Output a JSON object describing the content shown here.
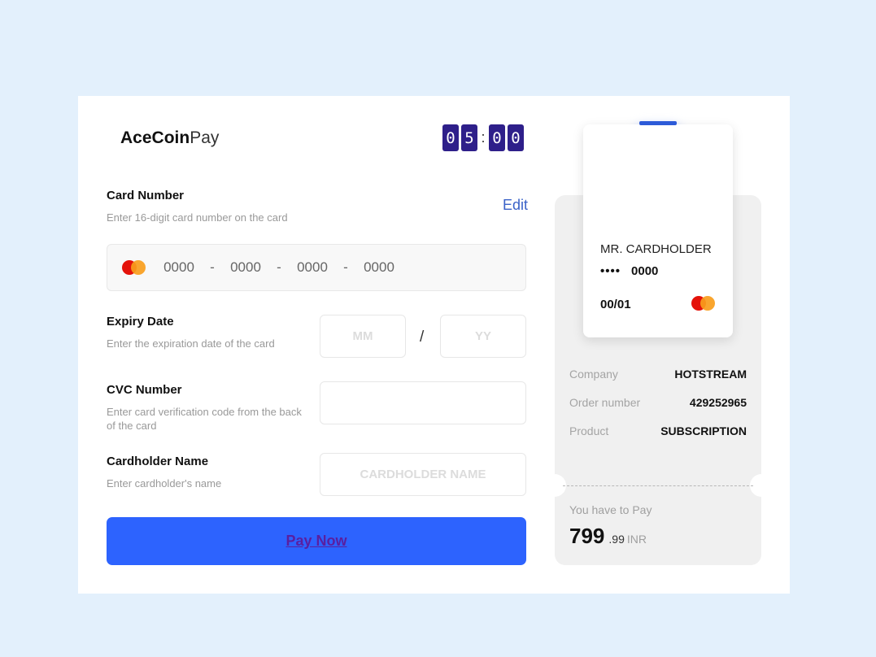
{
  "brand": {
    "bold": "AceCoin",
    "light": "Pay"
  },
  "timer": {
    "d1": "0",
    "d2": "5",
    "sep": ":",
    "d3": "0",
    "d4": "0"
  },
  "card_number": {
    "label": "Card Number",
    "description": "Enter 16-digit card number on the card",
    "edit_label": "Edit",
    "groups": [
      "0000",
      "0000",
      "0000",
      "0000"
    ],
    "separator": "-",
    "icon": "mastercard-icon"
  },
  "expiry": {
    "label": "Expiry Date",
    "description": "Enter the expiration date of the card",
    "month_placeholder": "MM",
    "year_placeholder": "YY",
    "separator": "/"
  },
  "cvc": {
    "label": "CVC Number",
    "description": "Enter card verification code from the back of the card"
  },
  "cardholder": {
    "label": "Cardholder Name",
    "description": "Enter cardholder's name",
    "placeholder": "CARDHOLDER NAME"
  },
  "pay_button": {
    "label": "Pay Now"
  },
  "preview_card": {
    "name": "MR. CARDHOLDER",
    "masked": "••••",
    "last4": "0000",
    "expiry": "00/01"
  },
  "summary": {
    "rows": [
      {
        "key": "Company",
        "value": "HOTSTREAM"
      },
      {
        "key": "Order number",
        "value": "429252965"
      },
      {
        "key": "Product",
        "value": "SUBSCRIPTION"
      }
    ],
    "pay_label": "You have to Pay",
    "amount_whole": "799",
    "amount_cents": ".99",
    "currency": "INR"
  },
  "colors": {
    "background": "#e3f0fc",
    "accent": "#2d63fe",
    "timer_bg": "#2e1f8a",
    "edit_link": "#3a62c8"
  }
}
